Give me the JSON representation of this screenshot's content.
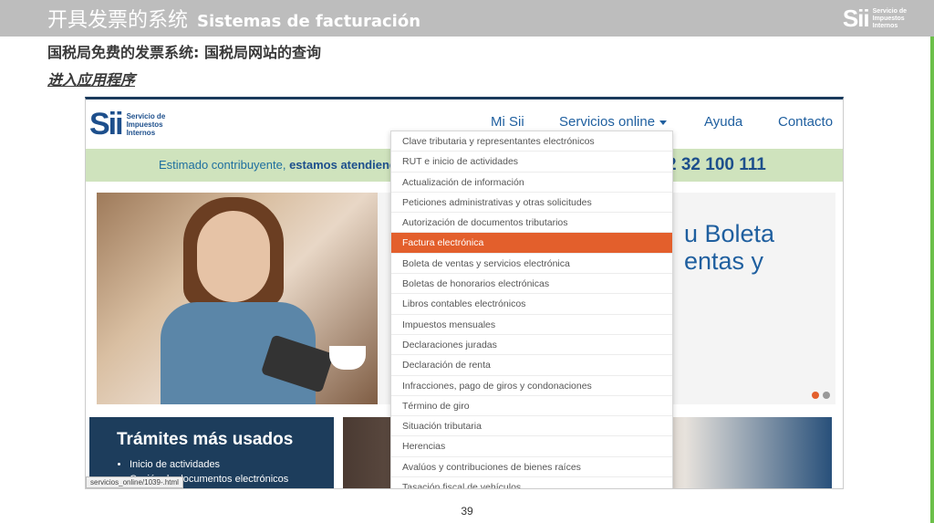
{
  "header": {
    "title_cn": "开具发票的系统",
    "title_es": "Sistemas de facturación",
    "logo_big": "Sii",
    "logo_small": [
      "Servicio de",
      "Impuestos",
      "Internos"
    ]
  },
  "subtitle": "国税局免费的发票系统: 国税局网站的查询",
  "subtitle2": "进入应用程序",
  "site": {
    "logo": "Sii",
    "logo_text": [
      "Servicio de",
      "Impuestos",
      "Internos"
    ],
    "nav": [
      "Mi Sii",
      "Servicios online",
      "Ayuda",
      "Contacto"
    ],
    "notice_text": "Estimado contribuyente, ",
    "notice_bold": "estamos atendiendo",
    "phone": "2 32 100 111",
    "hero_text": [
      "u Boleta",
      "entas y"
    ],
    "card_title": "Trámites más usados",
    "card_items": [
      "Inicio de actividades",
      "Cesión de documentos electrónicos"
    ],
    "status_url": "servicios_online/1039-.html",
    "dropdown": {
      "selected_index": 5,
      "items": [
        "Clave tributaria y representantes electrónicos",
        "RUT e inicio de actividades",
        "Actualización de información",
        "Peticiones administrativas y otras solicitudes",
        "Autorización de documentos tributarios",
        "Factura electrónica",
        "Boleta de ventas y servicios electrónica",
        "Boletas de honorarios electrónicas",
        "Libros contables electrónicos",
        "Impuestos mensuales",
        "Declaraciones juradas",
        "Declaración de renta",
        "Infracciones, pago de giros y condonaciones",
        "Término de giro",
        "Situación tributaria",
        "Herencias",
        "Avalúos y contribuciones de bienes raíces",
        "Tasación fiscal de vehículos"
      ]
    }
  },
  "page_number": "39",
  "colors": {
    "accent": "#e35f2c",
    "brand_blue": "#1d4f8c",
    "notice_green": "#cfe3bd"
  }
}
